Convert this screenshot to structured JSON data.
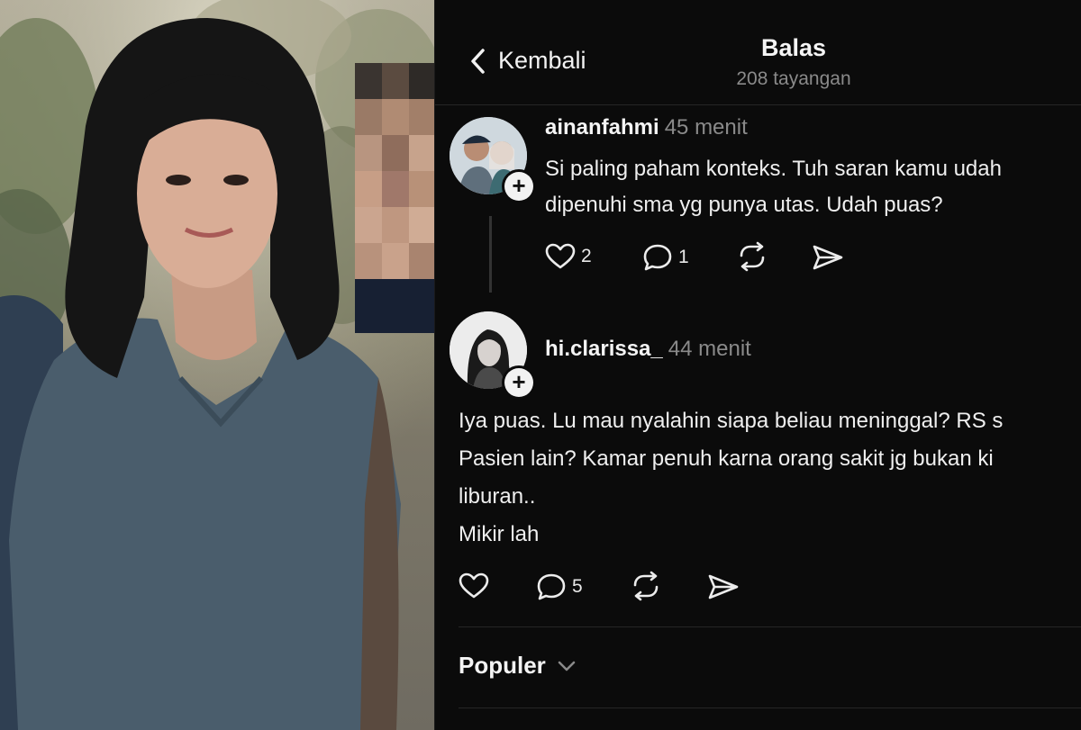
{
  "header": {
    "back_label": "Kembali",
    "title": "Balas",
    "views": "208 tayangan"
  },
  "replies": [
    {
      "username": "ainanfahmi",
      "time": "45 menit",
      "lines": [
        "Si paling paham konteks. Tuh saran kamu udah",
        "dipenuhi sma yg punya utas. Udah puas?"
      ],
      "likes": "2",
      "comments": "1"
    },
    {
      "username": "hi.clarissa_",
      "time": "44 menit",
      "lines": [
        "Iya puas. Lu mau nyalahin siapa beliau meninggal? RS s",
        "Pasien lain? Kamar penuh karna orang sakit jg bukan ki",
        "liburan..",
        "Mikir lah"
      ],
      "likes": "",
      "comments": "5"
    }
  ],
  "footer": {
    "sort_label": "Populer"
  },
  "icons": {
    "back": "chevron-left-icon",
    "like": "heart-icon",
    "comment": "speech-bubble-icon",
    "repost": "repost-icon",
    "share": "send-icon",
    "follow": "plus-icon",
    "dropdown": "chevron-down-icon"
  },
  "colors": {
    "background": "#0b0b0b",
    "text": "#f3f3f3",
    "muted": "#8a8a8a"
  }
}
